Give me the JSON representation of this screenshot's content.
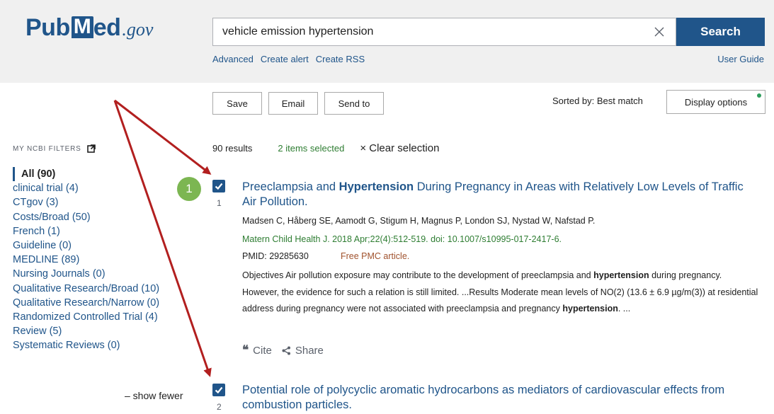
{
  "header": {
    "logo": {
      "pub": "Pub",
      "m": "M",
      "ed": "ed",
      "gov": ".gov"
    },
    "search": {
      "value": "vehicle emission hypertension",
      "button": "Search"
    },
    "links": {
      "advanced": "Advanced",
      "create_alert": "Create alert",
      "create_rss": "Create RSS",
      "user_guide": "User Guide"
    }
  },
  "toolbar": {
    "save": "Save",
    "email": "Email",
    "send_to": "Send to",
    "sorted_by": "Sorted by: Best match",
    "display_options": "Display options"
  },
  "sidebar": {
    "title": "MY NCBI FILTERS",
    "filters": [
      "All (90)",
      "clinical trial (4)",
      "CTgov (3)",
      "Costs/Broad (50)",
      "French (1)",
      "Guideline (0)",
      "MEDLINE (89)",
      "Nursing Journals (0)",
      "Qualitative Research/Broad (10)",
      "Qualitative Research/Narrow (0)",
      "Randomized Controlled Trial (4)",
      "Review (5)",
      "Systematic Reviews (0)"
    ],
    "show_fewer": "– show fewer"
  },
  "results": {
    "count": "90 results",
    "selected": "2 items selected",
    "clear_selection": "× Clear selection",
    "badge": "1",
    "items": [
      {
        "number": "1",
        "title_pre": "Preeclampsia and ",
        "title_bold": "Hypertension",
        "title_post": " During Pregnancy in Areas with Relatively Low Levels of Traffic Air Pollution.",
        "authors": "Madsen C, Håberg SE, Aamodt G, Stigum H, Magnus P, London SJ, Nystad W, Nafstad P.",
        "journal": "Matern Child Health J. 2018 Apr;22(4):512-519. doi: 10.1007/s10995-017-2417-6.",
        "pmid": "PMID: 29285630",
        "pmc": "Free PMC article.",
        "abs_1": "Objectives Air pollution exposure may contribute to the development of preeclampsia and ",
        "abs_b1": "hypertension",
        "abs_2": " during pregnancy. However, the evidence for such a relation is still limited. ...Results Moderate mean levels of NO(2) (13.6 ± 6.9 µg/m(3)) at residential address during pregnancy were not associated with preeclampsia and pregnancy ",
        "abs_b2": "hypertension",
        "abs_3": ". ...",
        "cite": "Cite",
        "share": "Share"
      },
      {
        "number": "2",
        "title": "Potential role of polycyclic aromatic hydrocarbons as mediators of cardiovascular effects from combustion particles."
      }
    ]
  },
  "colors": {
    "brand": "#20558a",
    "header_bg": "#f0f0f0",
    "green": "#2e7d32",
    "badge": "#7cb652",
    "arrow": "#b21f1f"
  }
}
